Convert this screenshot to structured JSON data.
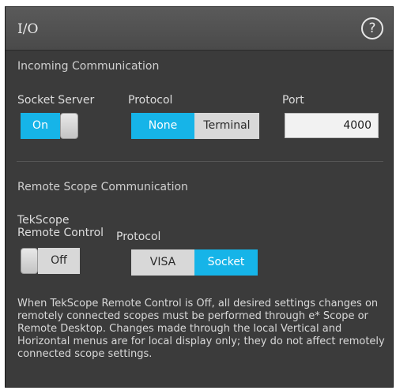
{
  "window": {
    "title": "I/O",
    "help_icon": "?"
  },
  "incoming": {
    "section_title": "Incoming Communication",
    "socket_server": {
      "label": "Socket Server",
      "state": "On"
    },
    "protocol": {
      "label": "Protocol",
      "options": [
        "None",
        "Terminal"
      ],
      "selected": "None"
    },
    "port": {
      "label": "Port",
      "value": "4000"
    }
  },
  "remote": {
    "section_title": "Remote Scope Communication",
    "tekscope_label_line1": "TekScope",
    "tekscope_label_line2": "Remote Control",
    "tekscope_state": "Off",
    "protocol": {
      "label": "Protocol",
      "options": [
        "VISA",
        "Socket"
      ],
      "selected": "Socket"
    }
  },
  "info_text": "When TekScope Remote Control is Off, all desired settings changes on remotely connected scopes must be performed through e* Scope or Remote Desktop. Changes made through the local Vertical and Horizontal menus are for local display only; they do not affect remotely connected scope settings.",
  "colors": {
    "accent": "#16b4e8",
    "panel": "#3b3b3b",
    "titlebar": "#4f4f4f"
  }
}
